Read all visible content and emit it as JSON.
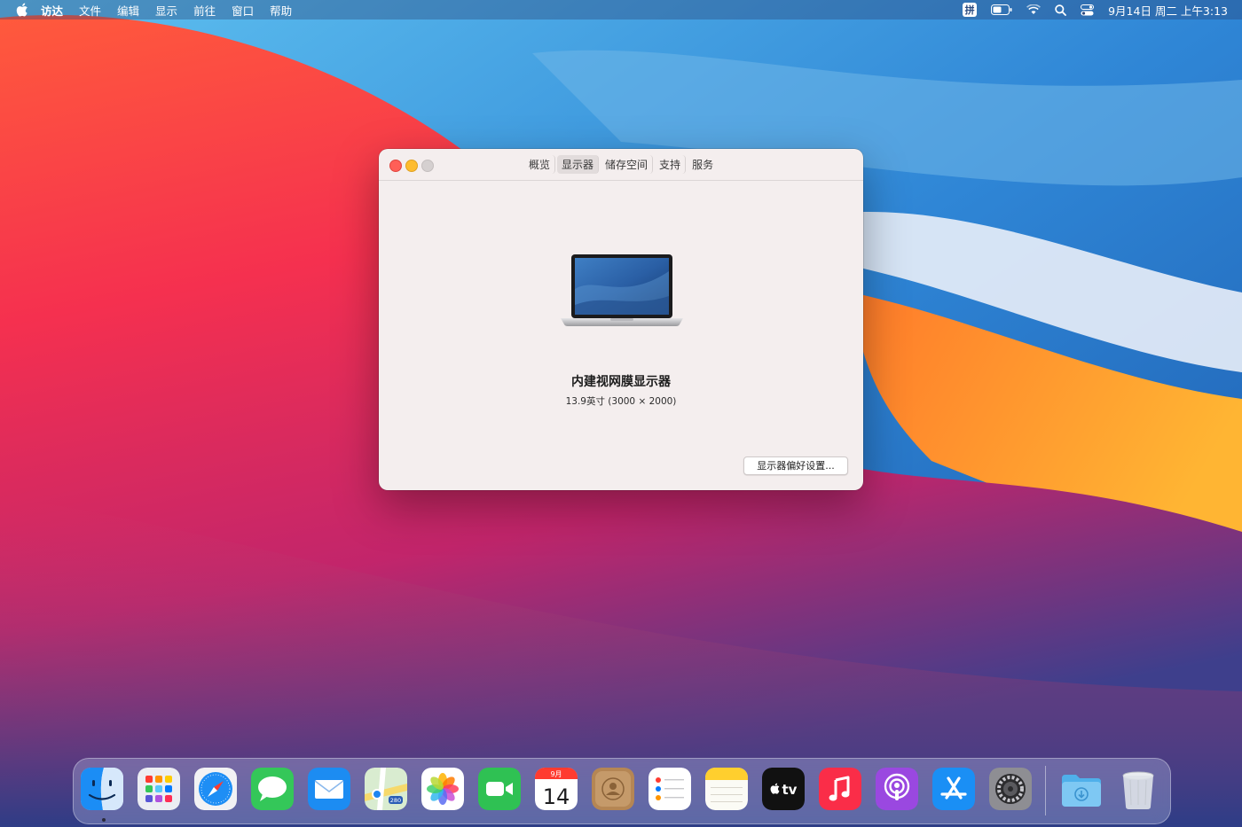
{
  "menubar": {
    "app_name": "访达",
    "items": [
      "文件",
      "编辑",
      "显示",
      "前往",
      "窗口",
      "帮助"
    ],
    "input_method": "拼",
    "clock": "9月14日 周二 上午3:13"
  },
  "window": {
    "tabs": [
      {
        "label": "概览",
        "active": false
      },
      {
        "label": "显示器",
        "active": true
      },
      {
        "label": "储存空间",
        "active": false
      },
      {
        "label": "支持",
        "active": false
      },
      {
        "label": "服务",
        "active": false
      }
    ],
    "display_name": "内建视网膜显示器",
    "display_size": "13.9英寸 (3000 × 2000)",
    "prefs_button": "显示器偏好设置..."
  },
  "dock": {
    "apps": [
      {
        "name": "finder",
        "icon": "finder-icon"
      },
      {
        "name": "launchpad",
        "icon": "launchpad-icon"
      },
      {
        "name": "safari",
        "icon": "safari-icon"
      },
      {
        "name": "messages",
        "icon": "messages-icon"
      },
      {
        "name": "mail",
        "icon": "mail-icon"
      },
      {
        "name": "maps",
        "icon": "maps-icon"
      },
      {
        "name": "photos",
        "icon": "photos-icon"
      },
      {
        "name": "facetime",
        "icon": "facetime-icon"
      },
      {
        "name": "calendar",
        "icon": "calendar-icon"
      },
      {
        "name": "contacts",
        "icon": "contacts-icon"
      },
      {
        "name": "reminders",
        "icon": "reminders-icon"
      },
      {
        "name": "notes",
        "icon": "notes-icon"
      },
      {
        "name": "apple-tv",
        "icon": "apple-tv-icon"
      },
      {
        "name": "music",
        "icon": "music-icon"
      },
      {
        "name": "podcasts",
        "icon": "podcasts-icon"
      },
      {
        "name": "app-store",
        "icon": "app-store-icon"
      },
      {
        "name": "system-preferences",
        "icon": "gear-icon"
      },
      {
        "name": "downloads",
        "icon": "downloads-folder-icon"
      },
      {
        "name": "trash",
        "icon": "trash-icon"
      }
    ],
    "calendar_month": "9月",
    "calendar_day": "14",
    "tv_label": "tv",
    "maps_badge": "280"
  },
  "colors": {
    "close": "#ff5f57",
    "minimize": "#febc2e",
    "zoom_disabled": "#d5d0d0",
    "window_bg": "#f4eeee"
  }
}
